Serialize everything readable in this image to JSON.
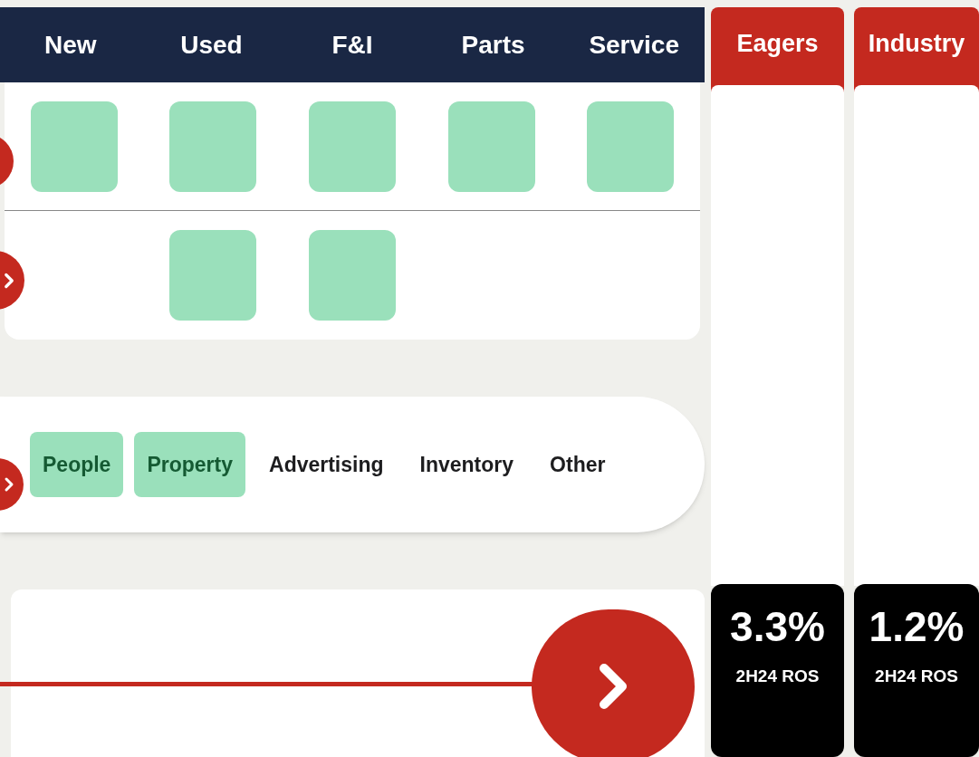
{
  "header": {
    "columns": [
      {
        "label": "New"
      },
      {
        "label": "Used"
      },
      {
        "label": "F&I"
      },
      {
        "label": "Parts"
      },
      {
        "label": "Service"
      }
    ]
  },
  "grid": {
    "rows": [
      {
        "cells": [
          {
            "filled": true
          },
          {
            "filled": true
          },
          {
            "filled": true
          },
          {
            "filled": true
          },
          {
            "filled": true
          }
        ]
      },
      {
        "cells": [
          {
            "filled": false
          },
          {
            "filled": true
          },
          {
            "filled": true
          },
          {
            "filled": false
          },
          {
            "filled": false
          }
        ]
      }
    ]
  },
  "costs": {
    "tags": [
      {
        "label": "People",
        "selected": true
      },
      {
        "label": "Property",
        "selected": true
      },
      {
        "label": "Advertising",
        "selected": false
      },
      {
        "label": "Inventory",
        "selected": false
      },
      {
        "label": "Other",
        "selected": false
      }
    ]
  },
  "comparison": [
    {
      "label": "Eagers",
      "value": "3.3%",
      "caption": "2H24 ROS"
    },
    {
      "label": "Industry",
      "value": "1.2%",
      "caption": "2H24 ROS"
    }
  ]
}
